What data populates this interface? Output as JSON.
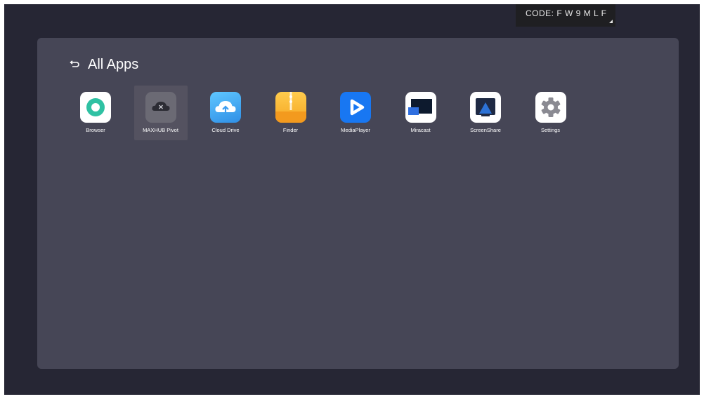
{
  "code_badge": {
    "text": "CODE: F W 9 M L F"
  },
  "header": {
    "title": "All Apps",
    "back_icon": "back-arrow-icon"
  },
  "apps": [
    {
      "label": "Browser",
      "icon": "browser-icon",
      "selected": false
    },
    {
      "label": "MAXHUB Pivot",
      "icon": "maxhub-pivot-icon",
      "selected": true
    },
    {
      "label": "Cloud Drive",
      "icon": "cloud-drive-icon",
      "selected": false
    },
    {
      "label": "Finder",
      "icon": "finder-icon",
      "selected": false
    },
    {
      "label": "MediaPlayer",
      "icon": "media-player-icon",
      "selected": false
    },
    {
      "label": "Miracast",
      "icon": "miracast-icon",
      "selected": false
    },
    {
      "label": "ScreenShare",
      "icon": "screenshare-icon",
      "selected": false
    },
    {
      "label": "Settings",
      "icon": "settings-icon",
      "selected": false
    }
  ],
  "colors": {
    "background": "#262634",
    "panel": "#464656",
    "selected_tile": "#545260"
  }
}
